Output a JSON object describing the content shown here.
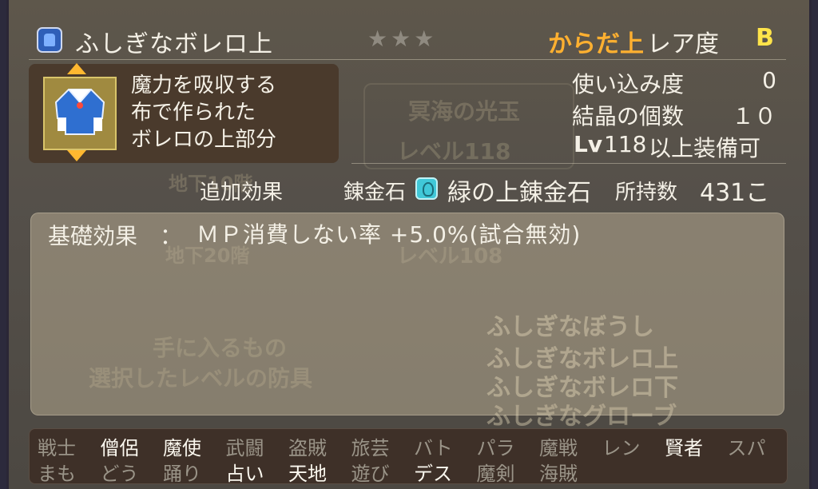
{
  "header": {
    "item_name": "ふしぎなボレロ上",
    "stars": "★★★",
    "category": "からだ上",
    "rarity_label": "レア度",
    "rarity_value": "B"
  },
  "description": [
    "魔力を吸収する",
    "布で作られた",
    "ボレロの上部分"
  ],
  "stats": {
    "usage_label": "使い込み度",
    "usage_value": "0",
    "crystal_label": "結晶の個数",
    "crystal_value": "１０",
    "level_prefix": "Lv",
    "level_value": "118",
    "level_suffix": "以上装備可"
  },
  "alchemy": {
    "tab_label": "追加効果",
    "stone_label": "錬金石",
    "stone_name": "緑の上錬金石",
    "owned_label": "所持数",
    "owned_value": "431こ"
  },
  "effects": {
    "basic_label": "基礎効果　：",
    "basic_text": "ＭＰ消費しない率 +5.0%(試合無効)"
  },
  "background_text": {
    "orb": "冥海の光玉",
    "level1": "レベル118",
    "level2": "レベル108",
    "floor1": "地下10階",
    "floor2": "地下20階",
    "obtain1": "手に入るもの",
    "obtain2": "選択したレベルの防具",
    "sets": [
      "ふしぎなぼうし",
      "ふしぎなボレロ上",
      "ふしぎなボレロ下",
      "ふしぎなグローブ"
    ]
  },
  "jobs": {
    "row1": [
      {
        "label": "戦士",
        "on": false
      },
      {
        "label": "僧侶",
        "on": true
      },
      {
        "label": "魔使",
        "on": true
      },
      {
        "label": "武闘",
        "on": false
      },
      {
        "label": "盗賊",
        "on": false
      },
      {
        "label": "旅芸",
        "on": false
      },
      {
        "label": "バト",
        "on": false
      },
      {
        "label": "パラ",
        "on": false
      },
      {
        "label": "魔戦",
        "on": false
      },
      {
        "label": "レン",
        "on": false
      },
      {
        "label": "賢者",
        "on": true
      },
      {
        "label": "スパ",
        "on": false
      }
    ],
    "row2": [
      {
        "label": "まも",
        "on": false
      },
      {
        "label": "どう",
        "on": false
      },
      {
        "label": "踊り",
        "on": false
      },
      {
        "label": "占い",
        "on": true
      },
      {
        "label": "天地",
        "on": true
      },
      {
        "label": "遊び",
        "on": false
      },
      {
        "label": "デス",
        "on": true
      },
      {
        "label": "魔剣",
        "on": false
      },
      {
        "label": "海賊",
        "on": false
      }
    ]
  },
  "colors": {
    "accent_orange": "#ffb030",
    "rarity_yellow": "#ffe44a",
    "alchemy_cyan": "#40c8d8",
    "text_main": "#f4f0e6",
    "text_dim": "#9a9488"
  },
  "icons": {
    "header": "bolero-top-icon",
    "alchemy": "green-alchemy-stone-icon"
  }
}
